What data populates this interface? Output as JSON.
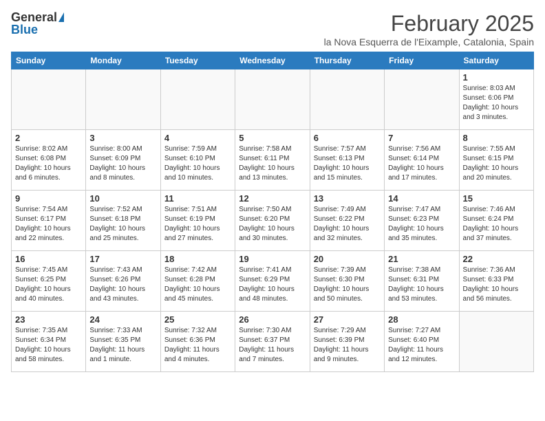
{
  "header": {
    "logo_general": "General",
    "logo_blue": "Blue",
    "month_title": "February 2025",
    "location": "la Nova Esquerra de l'Eixample, Catalonia, Spain"
  },
  "weekdays": [
    "Sunday",
    "Monday",
    "Tuesday",
    "Wednesday",
    "Thursday",
    "Friday",
    "Saturday"
  ],
  "weeks": [
    [
      {
        "day": "",
        "info": ""
      },
      {
        "day": "",
        "info": ""
      },
      {
        "day": "",
        "info": ""
      },
      {
        "day": "",
        "info": ""
      },
      {
        "day": "",
        "info": ""
      },
      {
        "day": "",
        "info": ""
      },
      {
        "day": "1",
        "info": "Sunrise: 8:03 AM\nSunset: 6:06 PM\nDaylight: 10 hours and 3 minutes."
      }
    ],
    [
      {
        "day": "2",
        "info": "Sunrise: 8:02 AM\nSunset: 6:08 PM\nDaylight: 10 hours and 6 minutes."
      },
      {
        "day": "3",
        "info": "Sunrise: 8:00 AM\nSunset: 6:09 PM\nDaylight: 10 hours and 8 minutes."
      },
      {
        "day": "4",
        "info": "Sunrise: 7:59 AM\nSunset: 6:10 PM\nDaylight: 10 hours and 10 minutes."
      },
      {
        "day": "5",
        "info": "Sunrise: 7:58 AM\nSunset: 6:11 PM\nDaylight: 10 hours and 13 minutes."
      },
      {
        "day": "6",
        "info": "Sunrise: 7:57 AM\nSunset: 6:13 PM\nDaylight: 10 hours and 15 minutes."
      },
      {
        "day": "7",
        "info": "Sunrise: 7:56 AM\nSunset: 6:14 PM\nDaylight: 10 hours and 17 minutes."
      },
      {
        "day": "8",
        "info": "Sunrise: 7:55 AM\nSunset: 6:15 PM\nDaylight: 10 hours and 20 minutes."
      }
    ],
    [
      {
        "day": "9",
        "info": "Sunrise: 7:54 AM\nSunset: 6:17 PM\nDaylight: 10 hours and 22 minutes."
      },
      {
        "day": "10",
        "info": "Sunrise: 7:52 AM\nSunset: 6:18 PM\nDaylight: 10 hours and 25 minutes."
      },
      {
        "day": "11",
        "info": "Sunrise: 7:51 AM\nSunset: 6:19 PM\nDaylight: 10 hours and 27 minutes."
      },
      {
        "day": "12",
        "info": "Sunrise: 7:50 AM\nSunset: 6:20 PM\nDaylight: 10 hours and 30 minutes."
      },
      {
        "day": "13",
        "info": "Sunrise: 7:49 AM\nSunset: 6:22 PM\nDaylight: 10 hours and 32 minutes."
      },
      {
        "day": "14",
        "info": "Sunrise: 7:47 AM\nSunset: 6:23 PM\nDaylight: 10 hours and 35 minutes."
      },
      {
        "day": "15",
        "info": "Sunrise: 7:46 AM\nSunset: 6:24 PM\nDaylight: 10 hours and 37 minutes."
      }
    ],
    [
      {
        "day": "16",
        "info": "Sunrise: 7:45 AM\nSunset: 6:25 PM\nDaylight: 10 hours and 40 minutes."
      },
      {
        "day": "17",
        "info": "Sunrise: 7:43 AM\nSunset: 6:26 PM\nDaylight: 10 hours and 43 minutes."
      },
      {
        "day": "18",
        "info": "Sunrise: 7:42 AM\nSunset: 6:28 PM\nDaylight: 10 hours and 45 minutes."
      },
      {
        "day": "19",
        "info": "Sunrise: 7:41 AM\nSunset: 6:29 PM\nDaylight: 10 hours and 48 minutes."
      },
      {
        "day": "20",
        "info": "Sunrise: 7:39 AM\nSunset: 6:30 PM\nDaylight: 10 hours and 50 minutes."
      },
      {
        "day": "21",
        "info": "Sunrise: 7:38 AM\nSunset: 6:31 PM\nDaylight: 10 hours and 53 minutes."
      },
      {
        "day": "22",
        "info": "Sunrise: 7:36 AM\nSunset: 6:33 PM\nDaylight: 10 hours and 56 minutes."
      }
    ],
    [
      {
        "day": "23",
        "info": "Sunrise: 7:35 AM\nSunset: 6:34 PM\nDaylight: 10 hours and 58 minutes."
      },
      {
        "day": "24",
        "info": "Sunrise: 7:33 AM\nSunset: 6:35 PM\nDaylight: 11 hours and 1 minute."
      },
      {
        "day": "25",
        "info": "Sunrise: 7:32 AM\nSunset: 6:36 PM\nDaylight: 11 hours and 4 minutes."
      },
      {
        "day": "26",
        "info": "Sunrise: 7:30 AM\nSunset: 6:37 PM\nDaylight: 11 hours and 7 minutes."
      },
      {
        "day": "27",
        "info": "Sunrise: 7:29 AM\nSunset: 6:39 PM\nDaylight: 11 hours and 9 minutes."
      },
      {
        "day": "28",
        "info": "Sunrise: 7:27 AM\nSunset: 6:40 PM\nDaylight: 11 hours and 12 minutes."
      },
      {
        "day": "",
        "info": ""
      }
    ]
  ]
}
